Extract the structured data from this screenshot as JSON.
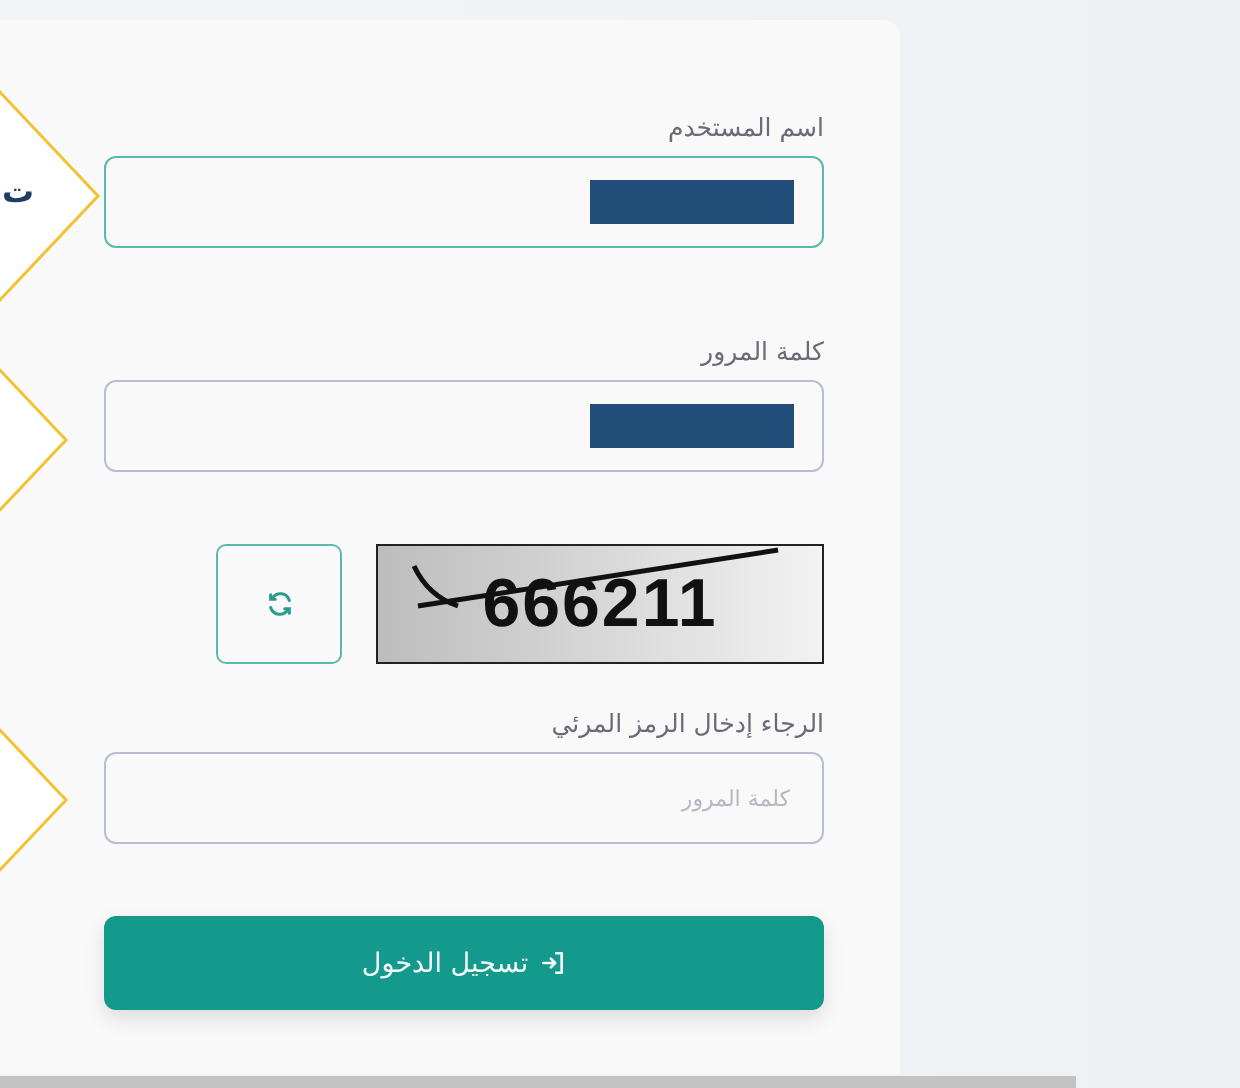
{
  "side_text": "ت",
  "fields": [
    {
      "label": "اسم المستخدم",
      "redacted": true,
      "focused": true
    },
    {
      "label": "كلمة المرور",
      "redacted": true,
      "focused": false
    }
  ],
  "captcha": {
    "code": "666211"
  },
  "captcha_field": {
    "label": "الرجاء إدخال الرمز المرئي",
    "placeholder": "كلمة المرور"
  },
  "login_button": {
    "label": "تسجيل الدخول"
  }
}
